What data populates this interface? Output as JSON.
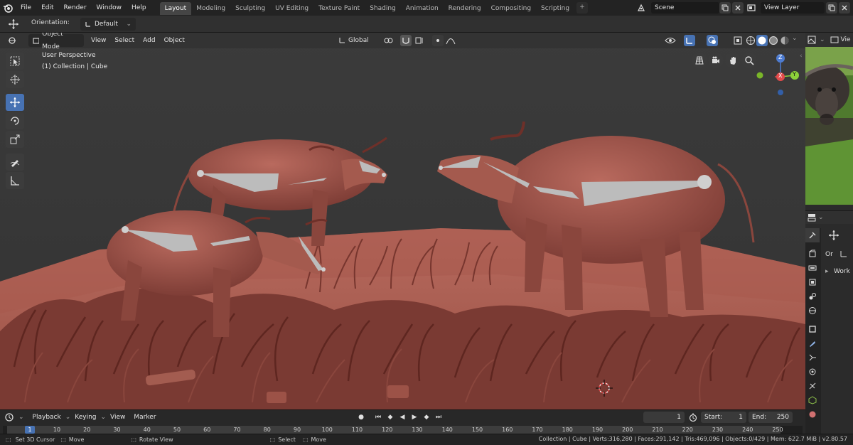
{
  "top_menu": [
    "File",
    "Edit",
    "Render",
    "Window",
    "Help"
  ],
  "workspace_tabs": [
    {
      "label": "Layout",
      "active": true
    },
    {
      "label": "Modeling",
      "active": false
    },
    {
      "label": "Sculpting",
      "active": false
    },
    {
      "label": "UV Editing",
      "active": false
    },
    {
      "label": "Texture Paint",
      "active": false
    },
    {
      "label": "Shading",
      "active": false
    },
    {
      "label": "Animation",
      "active": false
    },
    {
      "label": "Rendering",
      "active": false
    },
    {
      "label": "Compositing",
      "active": false
    },
    {
      "label": "Scripting",
      "active": false
    }
  ],
  "add_workspace_label": "+",
  "scene": {
    "value": "Scene"
  },
  "view_layer": {
    "value": "View Layer"
  },
  "tool_settings": {
    "orientation_label": "Orientation:",
    "orientation_value": "Default"
  },
  "viewport_header": {
    "mode": "Object Mode",
    "menus": [
      "View",
      "Select",
      "Add",
      "Object"
    ],
    "transform_orientation": "Global"
  },
  "viewport_overlay": {
    "line1": "User Perspective",
    "line2": "(1) Collection | Cube"
  },
  "gizmo": {
    "z": "Z",
    "x": "X",
    "y": "Y"
  },
  "toolbar_tools": [
    "select-box-icon",
    "cursor-icon",
    "move-icon",
    "rotate-icon",
    "scale-icon",
    "annotate-icon",
    "measure-icon"
  ],
  "right_panel": {
    "partial_label_1": "Vie",
    "partial_label_2": "Or",
    "tree_item": "Work"
  },
  "timeline": {
    "menus": [
      "Playback",
      "Keying",
      "View",
      "Marker"
    ],
    "current_frame": "1",
    "start_label": "Start:",
    "start_value": "1",
    "end_label": "End:",
    "end_value": "250",
    "ruler": [
      "1",
      "10",
      "20",
      "30",
      "40",
      "50",
      "60",
      "70",
      "80",
      "90",
      "100",
      "110",
      "120",
      "130",
      "140",
      "150",
      "160",
      "170",
      "180",
      "190",
      "200",
      "210",
      "220",
      "230",
      "240",
      "250"
    ]
  },
  "status": {
    "left": [
      "Set 3D Cursor",
      "Move",
      "Rotate View",
      "Select",
      "Move"
    ],
    "right": "Collection | Cube | Verts:316,280 | Faces:291,142 | Tris:469,096 | Objects:0/429 | Mem: 622.7 MiB | v2.80.57"
  },
  "colors": {
    "accent": "#4772b3",
    "terrain": "#a8564b",
    "buffalo": "#8f4b43",
    "viewport_bg": "#3a3a3a"
  }
}
